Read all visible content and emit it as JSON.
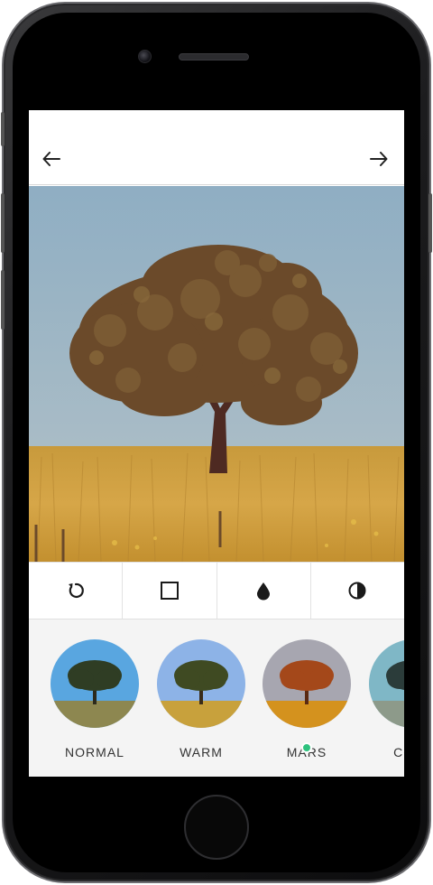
{
  "app": {
    "nav": {
      "back_icon": "arrow-left-icon",
      "forward_icon": "arrow-right-icon"
    },
    "tools": [
      {
        "icon": "rotate-icon"
      },
      {
        "icon": "crop-square-icon"
      },
      {
        "icon": "drop-icon"
      },
      {
        "icon": "contrast-icon"
      }
    ],
    "filters": [
      {
        "label": "NORMAL",
        "sky": "#5aa5dd",
        "ground": "#8f8a52",
        "tree": "#2c3a22"
      },
      {
        "label": "WARM",
        "sky": "#8fb3e6",
        "ground": "#c8a23c",
        "tree": "#3f4a22"
      },
      {
        "label": "MARS",
        "sky": "#a9a8b0",
        "ground": "#d4921e",
        "tree": "#a4481a"
      },
      {
        "label": "COOL",
        "sky": "#7fb7c6",
        "ground": "#8d9a8a",
        "tree": "#2b3c3a"
      }
    ],
    "selected_filter": "MARS",
    "colors": {
      "accent": "#2ec27e"
    }
  }
}
